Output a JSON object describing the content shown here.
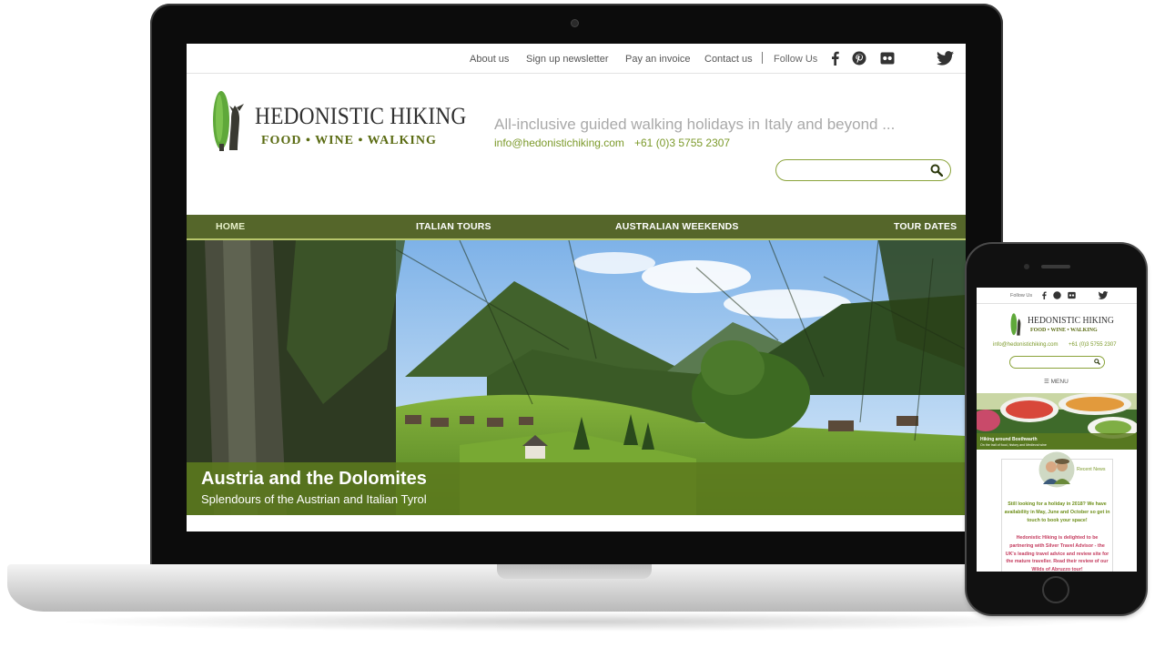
{
  "desktop": {
    "toplinks": [
      "About us",
      "Sign up newsletter",
      "Pay an invoice",
      "Contact us"
    ],
    "follow_label": "Follow Us",
    "social_icons": [
      "facebook-icon",
      "pinterest-icon",
      "flickr-icon",
      "twitter-icon"
    ],
    "logo": {
      "title": "HEDONISTIC HIKING",
      "subtitle": "FOOD • WINE • WALKING"
    },
    "tagline": "All-inclusive guided walking holidays in Italy and beyond ...",
    "email": "info@hedonistichiking.com",
    "phone": "+61 (0)3 5755 2307",
    "search": {
      "placeholder": ""
    },
    "nav": [
      "HOME",
      "ITALIAN TOURS",
      "AUSTRALIAN WEEKENDS",
      "TOUR DATES"
    ],
    "hero": {
      "title": "Austria and the Dolomites",
      "subtitle": "Splendours of the Austrian and Italian Tyrol"
    }
  },
  "mobile": {
    "follow_label": "Follow Us",
    "logo": {
      "title": "HEDONISTIC HIKING",
      "subtitle": "FOOD • WINE • WALKING"
    },
    "email": "info@hedonistichiking.com",
    "phone": "+61 (0)3 5755 2307",
    "menu_label": "☰ MENU",
    "hero": {
      "title": "Hiking around Bosthwarth",
      "subtitle": "On the trail of food, history and Medieval wine"
    },
    "recent_news": "Recent News",
    "news1": "Still looking for a holiday in 2018? We have availability in May, June and October so get in touch to book your space!",
    "news2": "Hedonistic Hiking is delighted to be partnering with Silver Travel Advisor - the UK's leading travel advice and review site for the mature traveller. Read their review of our Wilds of Abruzzo tour!"
  },
  "colors": {
    "nav_green": "#55662a",
    "accent_green": "#7c9a2b",
    "caption_green": "#5c7a1e"
  }
}
